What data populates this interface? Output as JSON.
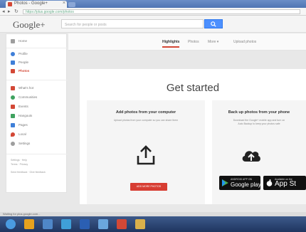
{
  "browser": {
    "tab_title": "Photos - Google+",
    "tab_close": "×",
    "nav_back": "◂",
    "nav_forward": "▸",
    "nav_reload": "↻",
    "address": "https://plus.google.com/photos"
  },
  "header": {
    "logo": "Google+",
    "search_placeholder": "Search for people or posts",
    "search_button_icon": "search-icon"
  },
  "sidebar": {
    "items": [
      {
        "label": "Home",
        "icon": "home-icon",
        "color": "#9e9e9e",
        "active": false
      },
      {
        "label": "Profile",
        "icon": "profile-icon",
        "color": "#3f7fd8",
        "active": false
      },
      {
        "label": "People",
        "icon": "people-icon",
        "color": "#3f7fd8",
        "active": false
      },
      {
        "label": "Photos",
        "icon": "photos-icon",
        "color": "#d34836",
        "active": true
      },
      {
        "label": "What's hot",
        "icon": "hot-icon",
        "color": "#d34836",
        "active": false
      },
      {
        "label": "Communities",
        "icon": "communities-icon",
        "color": "#3fa25f",
        "active": false
      },
      {
        "label": "Events",
        "icon": "events-icon",
        "color": "#d34836",
        "active": false
      },
      {
        "label": "Hangouts",
        "icon": "hangouts-icon",
        "color": "#3fa25f",
        "active": false
      },
      {
        "label": "Pages",
        "icon": "pages-icon",
        "color": "#3f7fd8",
        "active": false
      },
      {
        "label": "Local",
        "icon": "local-icon",
        "color": "#d34836",
        "active": false
      },
      {
        "label": "Settings",
        "icon": "settings-icon",
        "color": "#9e9e9e",
        "active": false
      }
    ],
    "footer_line1": "Settings · Help",
    "footer_line2": "Terms · Privacy",
    "footer_line3": "Send feedback · Give feedback"
  },
  "subnav": {
    "tabs": [
      {
        "label": "Highlights",
        "active": true
      },
      {
        "label": "Photos",
        "active": false
      },
      {
        "label": "More ▾",
        "active": false
      },
      {
        "label": "Upload photos",
        "active": false
      }
    ]
  },
  "main": {
    "title": "Get started",
    "card_upload": {
      "title": "Add photos from your computer",
      "description": "Upload photos from your computer so you can share them",
      "icon": "upload-icon",
      "button": "ADD MORE PHOTOS"
    },
    "card_backup": {
      "title": "Back up photos from your phone",
      "description": "Download the Google+ mobile app and turn on Auto Backup to keep your photos safe",
      "icon": "cloud-upload-icon",
      "google_play_small": "ANDROID APP ON",
      "google_play_big": "Google play",
      "app_store_small": "Available on the",
      "app_store_big": "App St"
    }
  },
  "statusbar": {
    "text": "Waiting for plus.google.com..."
  },
  "taskbar": {
    "icons": [
      {
        "name": "start-icon",
        "color": "#4a9be0"
      },
      {
        "name": "ie-icon",
        "color": "#e6a21e"
      },
      {
        "name": "explorer-icon",
        "color": "#4f87c8"
      },
      {
        "name": "media-icon",
        "color": "#3f9fd8"
      },
      {
        "name": "word-icon",
        "color": "#2b5fb3"
      },
      {
        "name": "app-icon",
        "color": "#6aa6de"
      },
      {
        "name": "chrome-icon",
        "color": "#d34836"
      },
      {
        "name": "folder-icon",
        "color": "#d9b04b"
      }
    ]
  },
  "colors": {
    "google_red": "#d34836",
    "google_blue": "#4d90fe"
  }
}
